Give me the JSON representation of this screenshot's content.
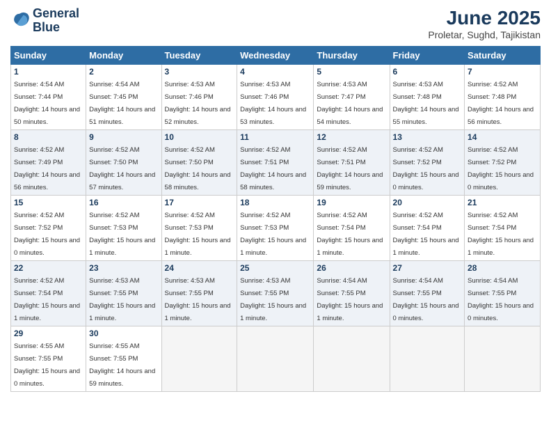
{
  "header": {
    "logo_line1": "General",
    "logo_line2": "Blue",
    "title": "June 2025",
    "subtitle": "Proletar, Sughd, Tajikistan"
  },
  "days_of_week": [
    "Sunday",
    "Monday",
    "Tuesday",
    "Wednesday",
    "Thursday",
    "Friday",
    "Saturday"
  ],
  "weeks": [
    [
      {
        "day": "1",
        "sunrise": "4:54 AM",
        "sunset": "7:44 PM",
        "daylight": "14 hours and 50 minutes."
      },
      {
        "day": "2",
        "sunrise": "4:54 AM",
        "sunset": "7:45 PM",
        "daylight": "14 hours and 51 minutes."
      },
      {
        "day": "3",
        "sunrise": "4:53 AM",
        "sunset": "7:46 PM",
        "daylight": "14 hours and 52 minutes."
      },
      {
        "day": "4",
        "sunrise": "4:53 AM",
        "sunset": "7:46 PM",
        "daylight": "14 hours and 53 minutes."
      },
      {
        "day": "5",
        "sunrise": "4:53 AM",
        "sunset": "7:47 PM",
        "daylight": "14 hours and 54 minutes."
      },
      {
        "day": "6",
        "sunrise": "4:53 AM",
        "sunset": "7:48 PM",
        "daylight": "14 hours and 55 minutes."
      },
      {
        "day": "7",
        "sunrise": "4:52 AM",
        "sunset": "7:48 PM",
        "daylight": "14 hours and 56 minutes."
      }
    ],
    [
      {
        "day": "8",
        "sunrise": "4:52 AM",
        "sunset": "7:49 PM",
        "daylight": "14 hours and 56 minutes."
      },
      {
        "day": "9",
        "sunrise": "4:52 AM",
        "sunset": "7:50 PM",
        "daylight": "14 hours and 57 minutes."
      },
      {
        "day": "10",
        "sunrise": "4:52 AM",
        "sunset": "7:50 PM",
        "daylight": "14 hours and 58 minutes."
      },
      {
        "day": "11",
        "sunrise": "4:52 AM",
        "sunset": "7:51 PM",
        "daylight": "14 hours and 58 minutes."
      },
      {
        "day": "12",
        "sunrise": "4:52 AM",
        "sunset": "7:51 PM",
        "daylight": "14 hours and 59 minutes."
      },
      {
        "day": "13",
        "sunrise": "4:52 AM",
        "sunset": "7:52 PM",
        "daylight": "15 hours and 0 minutes."
      },
      {
        "day": "14",
        "sunrise": "4:52 AM",
        "sunset": "7:52 PM",
        "daylight": "15 hours and 0 minutes."
      }
    ],
    [
      {
        "day": "15",
        "sunrise": "4:52 AM",
        "sunset": "7:52 PM",
        "daylight": "15 hours and 0 minutes."
      },
      {
        "day": "16",
        "sunrise": "4:52 AM",
        "sunset": "7:53 PM",
        "daylight": "15 hours and 1 minute."
      },
      {
        "day": "17",
        "sunrise": "4:52 AM",
        "sunset": "7:53 PM",
        "daylight": "15 hours and 1 minute."
      },
      {
        "day": "18",
        "sunrise": "4:52 AM",
        "sunset": "7:53 PM",
        "daylight": "15 hours and 1 minute."
      },
      {
        "day": "19",
        "sunrise": "4:52 AM",
        "sunset": "7:54 PM",
        "daylight": "15 hours and 1 minute."
      },
      {
        "day": "20",
        "sunrise": "4:52 AM",
        "sunset": "7:54 PM",
        "daylight": "15 hours and 1 minute."
      },
      {
        "day": "21",
        "sunrise": "4:52 AM",
        "sunset": "7:54 PM",
        "daylight": "15 hours and 1 minute."
      }
    ],
    [
      {
        "day": "22",
        "sunrise": "4:52 AM",
        "sunset": "7:54 PM",
        "daylight": "15 hours and 1 minute."
      },
      {
        "day": "23",
        "sunrise": "4:53 AM",
        "sunset": "7:55 PM",
        "daylight": "15 hours and 1 minute."
      },
      {
        "day": "24",
        "sunrise": "4:53 AM",
        "sunset": "7:55 PM",
        "daylight": "15 hours and 1 minute."
      },
      {
        "day": "25",
        "sunrise": "4:53 AM",
        "sunset": "7:55 PM",
        "daylight": "15 hours and 1 minute."
      },
      {
        "day": "26",
        "sunrise": "4:54 AM",
        "sunset": "7:55 PM",
        "daylight": "15 hours and 1 minute."
      },
      {
        "day": "27",
        "sunrise": "4:54 AM",
        "sunset": "7:55 PM",
        "daylight": "15 hours and 0 minutes."
      },
      {
        "day": "28",
        "sunrise": "4:54 AM",
        "sunset": "7:55 PM",
        "daylight": "15 hours and 0 minutes."
      }
    ],
    [
      {
        "day": "29",
        "sunrise": "4:55 AM",
        "sunset": "7:55 PM",
        "daylight": "15 hours and 0 minutes."
      },
      {
        "day": "30",
        "sunrise": "4:55 AM",
        "sunset": "7:55 PM",
        "daylight": "14 hours and 59 minutes."
      },
      null,
      null,
      null,
      null,
      null
    ]
  ],
  "labels": {
    "sunrise": "Sunrise:",
    "sunset": "Sunset:",
    "daylight": "Daylight:"
  }
}
